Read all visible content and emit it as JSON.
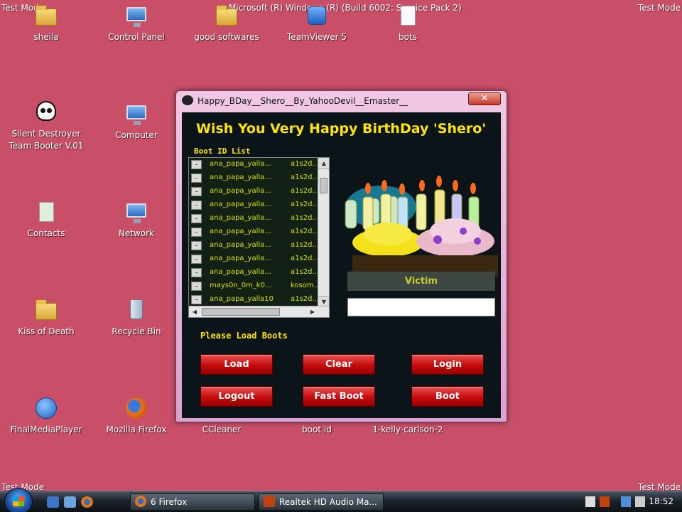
{
  "watermark": {
    "top_left": "Test Mode",
    "top_center": "Microsoft (R) Windows (R) (Build 6002: Service Pack 2)",
    "top_right": "Test Mode",
    "bottom_left": "Test Mode",
    "bottom_right": "Test Mode"
  },
  "desktop": {
    "icons": [
      {
        "label": "sheila",
        "icon": "folder-icon"
      },
      {
        "label": "Control Panel",
        "icon": "control-panel-icon"
      },
      {
        "label": "good softwares",
        "icon": "folder-icon"
      },
      {
        "label": "TeamViewer 5",
        "icon": "teamviewer-icon"
      },
      {
        "label": "bots",
        "icon": "document-icon"
      },
      {
        "label": "Silent Destroyer Team Booter V.01",
        "icon": "skull-icon"
      },
      {
        "label": "Computer",
        "icon": "computer-icon"
      },
      {
        "label": "Contacts",
        "icon": "contacts-icon"
      },
      {
        "label": "Network",
        "icon": "network-icon"
      },
      {
        "label": "Kiss of Death",
        "icon": "folder-icon"
      },
      {
        "label": "Recycle Bin",
        "icon": "recycle-bin-icon"
      },
      {
        "label": "FinalMediaPlayer",
        "icon": "media-player-icon"
      },
      {
        "label": "Mozilla Firefox",
        "icon": "firefox-icon"
      },
      {
        "label": "CCleaner",
        "icon": "ccleaner-icon"
      },
      {
        "label": "boot id",
        "icon": "document-icon"
      },
      {
        "label": "1-kelly-carlson-2",
        "icon": "image-icon"
      }
    ]
  },
  "window": {
    "title": "Happy_BDay__Shero__By_YahooDevil__Emaster__",
    "close_label": "✕",
    "headline": "Wish You Very Happy BirthDay  'Shero'",
    "list_label": "Boot ID List",
    "list_rows": [
      {
        "name": "ana_papa_yalla...",
        "pass": "a1s2d..."
      },
      {
        "name": "ana_papa_yalla...",
        "pass": "a1s2d..."
      },
      {
        "name": "ana_papa_yalla...",
        "pass": "a1s2d..."
      },
      {
        "name": "ana_papa_yalla...",
        "pass": "a1s2d..."
      },
      {
        "name": "ana_papa_yalla...",
        "pass": "a1s2d..."
      },
      {
        "name": "ana_papa_yalla...",
        "pass": "a1s2d..."
      },
      {
        "name": "ana_papa_yalla...",
        "pass": "a1s2d..."
      },
      {
        "name": "ana_papa_yalla...",
        "pass": "a1s2d..."
      },
      {
        "name": "ana_papa_yalla...",
        "pass": "a1s2d..."
      },
      {
        "name": "mays0n_0m_k0...",
        "pass": "kosom..."
      },
      {
        "name": "ana_papa_yalla10",
        "pass": "a1s2d..."
      }
    ],
    "victim_label": "Victim",
    "victim_value": "",
    "status": "Please Load Boots",
    "buttons": {
      "load": "Load",
      "clear": "Clear",
      "login": "Login",
      "logout": "Logout",
      "fast_boot": "Fast Boot",
      "boot": "Boot"
    }
  },
  "taskbar": {
    "tasks": [
      {
        "label": "6 Firefox",
        "icon": "firefox-icon"
      },
      {
        "label": "Realtek HD Audio Ma...",
        "icon": "speaker-icon"
      }
    ],
    "clock": "18:52"
  },
  "colors": {
    "desktop": "#c94f68",
    "headline": "#ffe600",
    "button": "#c40b0b"
  }
}
